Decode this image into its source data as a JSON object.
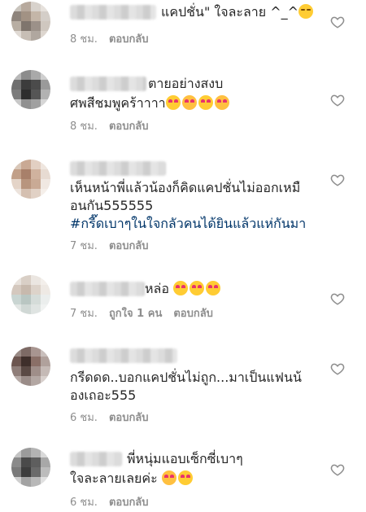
{
  "comments": [
    {
      "id": "c1",
      "lines": [
        "แคปชั่น\" ใจละลาย ^_^"
      ],
      "time": "8 ชม.",
      "reply": "ตอบกลับ"
    },
    {
      "id": "c2",
      "lines": [
        "ตายอย่างสงบ",
        "ศพสีชมพูคร้าาาา"
      ],
      "time": "8 ชม.",
      "reply": "ตอบกลับ"
    },
    {
      "id": "c3",
      "lines": [
        "เห็นหน้าพี่แล้วน้องก็คิดแคปชั่นไม่ออกเหมื",
        "อนกัน555555"
      ],
      "hashtag": "#กรี๊ดเบาๆในใจกลัวคนได้ยินแล้วแห่กันมา",
      "time": "7 ชม.",
      "reply": "ตอบกลับ"
    },
    {
      "id": "c4",
      "lines": [
        "หล่อ"
      ],
      "time": "7 ชม.",
      "likes": "ถูกใจ 1 คน",
      "reply": "ตอบกลับ"
    },
    {
      "id": "c5",
      "lines": [
        "กรีดดด..บอกแคปชั่นไม่ถูก...มาเป็นแฟนน้",
        "องเถอะ555"
      ],
      "time": "6 ชม.",
      "reply": "ตอบกลับ"
    },
    {
      "id": "c6",
      "lines": [
        "พี่หนุ่มแอบเซ็กซี่เบาๆ",
        "ใจละลายเลยค่ะ"
      ],
      "time": "6 ชม.",
      "reply": "ตอบกลับ"
    }
  ],
  "icons": {
    "like": "heart-outline-icon"
  },
  "colors": {
    "text": "#262626",
    "meta": "#8e8e8e",
    "hashtag": "#003569"
  }
}
